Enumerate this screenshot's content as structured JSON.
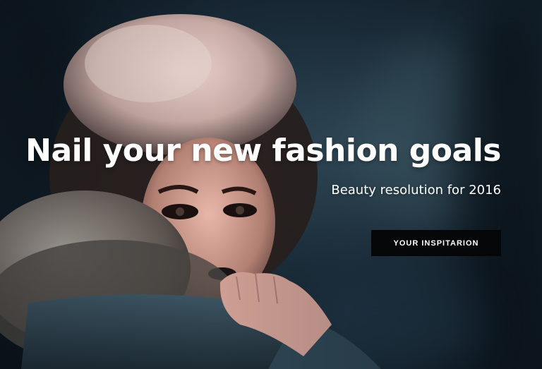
{
  "hero": {
    "headline": "Nail your new fashion goals",
    "subheadline": "Beauty resolution for 2016",
    "cta_label": "YOUR INSPITARION"
  },
  "colors": {
    "text": "#ffffff",
    "button_background": "#050607",
    "backdrop": "#1f3341"
  }
}
